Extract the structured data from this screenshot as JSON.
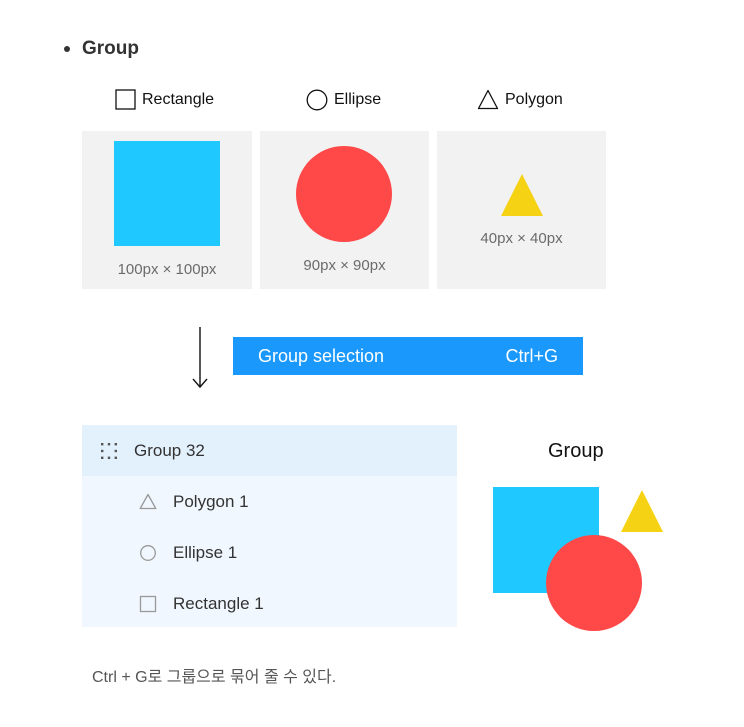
{
  "heading": {
    "text": "Group"
  },
  "shapes": [
    {
      "label": "Rectangle",
      "caption": "100px × 100px",
      "icon": "square-icon",
      "color": "#1fc8fe"
    },
    {
      "label": "Ellipse",
      "caption": "90px × 90px",
      "icon": "circle-icon",
      "color": "#ff4848"
    },
    {
      "label": "Polygon",
      "caption": "40px × 40px",
      "icon": "triangle-icon",
      "color": "#f5d214"
    }
  ],
  "action": {
    "label": "Group selection",
    "shortcut": "Ctrl+G",
    "color": "#1a98fc"
  },
  "layers": {
    "group": {
      "name": "Group 32",
      "icon": "group-dashed-icon"
    },
    "children": [
      {
        "name": "Polygon 1",
        "icon": "triangle-outline-icon"
      },
      {
        "name": "Ellipse 1",
        "icon": "circle-outline-icon"
      },
      {
        "name": "Rectangle 1",
        "icon": "square-outline-icon"
      }
    ]
  },
  "result": {
    "title": "Group"
  },
  "note": "Ctrl + G로 그룹으로 묶어 줄 수 있다."
}
